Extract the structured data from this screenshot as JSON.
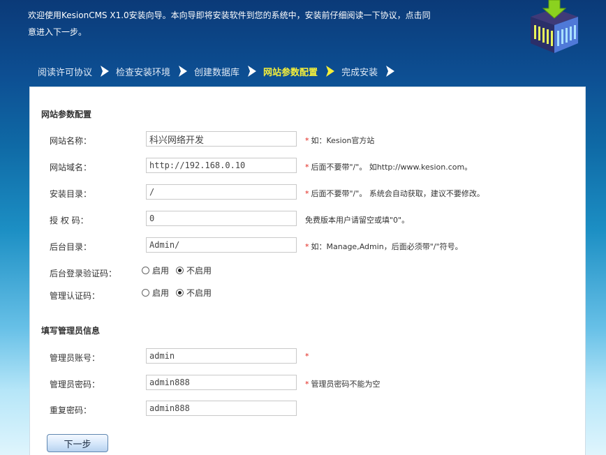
{
  "header": {
    "intro_line1": "欢迎使用KesionCMS X1.0安装向导。本向导即将安装软件到您的系统中，安装前仔细阅读一下协议，点击同",
    "intro_line2": "意进入下一步。",
    "logo_icon": "install-box-icon"
  },
  "steps": [
    {
      "label": "阅读许可协议",
      "active": false
    },
    {
      "label": "检查安装环境",
      "active": false
    },
    {
      "label": "创建数据库",
      "active": false
    },
    {
      "label": "网站参数配置",
      "active": true
    },
    {
      "label": "完成安装",
      "active": false
    }
  ],
  "site_config": {
    "title": "网站参数配置",
    "site_name": {
      "label": "网站名称：",
      "value": "科兴网络开发",
      "hint": "如：Kesion官方站",
      "required": "*"
    },
    "site_domain": {
      "label": "网站域名：",
      "value": "http://192.168.0.10",
      "hint": "后面不要带\"/\"。 如http://www.kesion.com。",
      "required": "*"
    },
    "install_dir": {
      "label": "安装目录：",
      "value": "/",
      "hint": "后面不要带\"/\"。 系统会自动获取，建议不要修改。",
      "required": "*"
    },
    "auth_code": {
      "label": "授 权 码：",
      "value": "0",
      "hint": "免费版本用户请留空或填\"0\"。"
    },
    "admin_dir": {
      "label": "后台目录：",
      "value": "Admin/",
      "hint": "如：Manage,Admin，后面必须带\"/\"符号。",
      "required": "*"
    },
    "login_captcha": {
      "label": "后台登录验证码：",
      "option_on": "启用",
      "option_off": "不启用",
      "selected": "off"
    },
    "admin_auth_code": {
      "label": "管理认证码：",
      "option_on": "启用",
      "option_off": "不启用",
      "selected": "off"
    }
  },
  "admin_info": {
    "title": "填写管理员信息",
    "account": {
      "label": "管理员账号：",
      "value": "admin",
      "required": "*"
    },
    "password": {
      "label": "管理员密码：",
      "value": "admin888",
      "hint": "管理员密码不能为空",
      "required": "*"
    },
    "repeat_password": {
      "label": "重复密码：",
      "value": "admin888"
    }
  },
  "next_button": {
    "label": "下一步"
  },
  "colors": {
    "active_step": "#f5ef3a",
    "required_star": "#e2231a",
    "header_bg": "#0b3a78"
  }
}
